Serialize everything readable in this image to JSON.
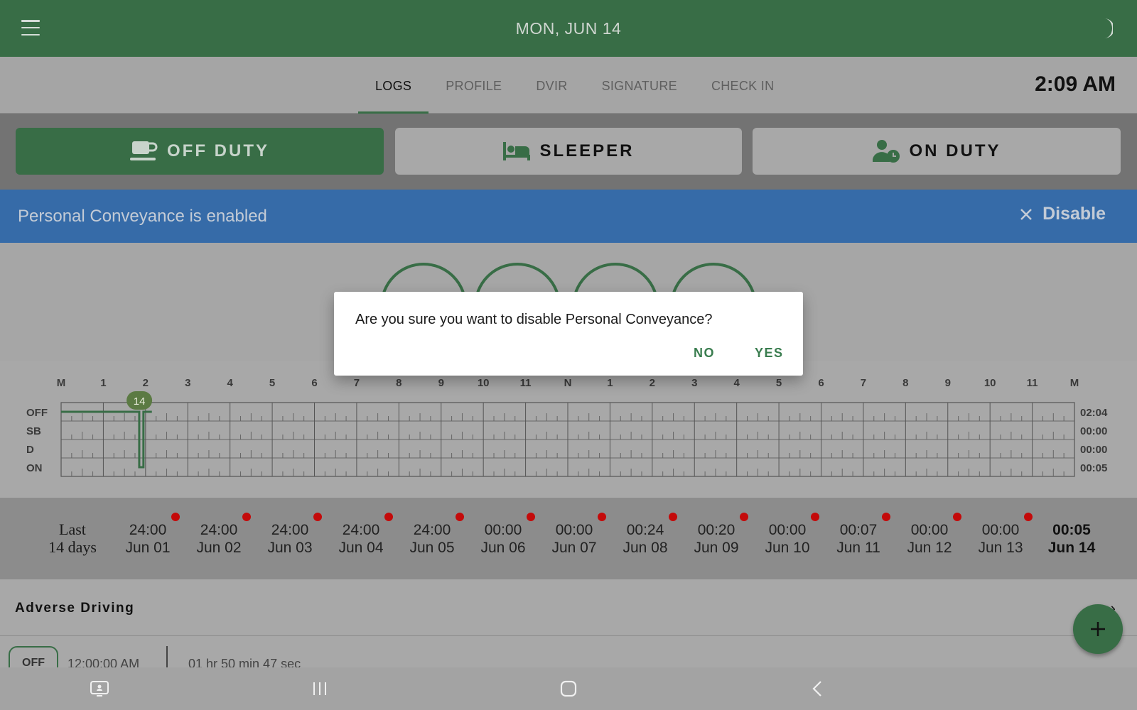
{
  "header": {
    "date": "MON, JUN 14"
  },
  "tabs": [
    {
      "label": "LOGS",
      "active": true
    },
    {
      "label": "PROFILE",
      "active": false
    },
    {
      "label": "DVIR",
      "active": false
    },
    {
      "label": "SIGNATURE",
      "active": false
    },
    {
      "label": "CHECK IN",
      "active": false
    }
  ],
  "clock": "2:09 AM",
  "status_buttons": {
    "off_duty": "OFF DUTY",
    "sleeper": "SLEEPER",
    "on_duty": "ON DUTY",
    "selected": "off_duty"
  },
  "banner": {
    "message": "Personal Conveyance is enabled",
    "action": "Disable"
  },
  "log_chart": {
    "hour_labels": [
      "M",
      "1",
      "2",
      "3",
      "4",
      "5",
      "6",
      "7",
      "8",
      "9",
      "10",
      "11",
      "N",
      "1",
      "2",
      "3",
      "4",
      "5",
      "6",
      "7",
      "8",
      "9",
      "10",
      "11",
      "M"
    ],
    "rows": [
      "OFF",
      "SB",
      "D",
      "ON"
    ],
    "totals": [
      "02:04",
      "00:00",
      "00:00",
      "00:05"
    ],
    "current_day_marker": "14"
  },
  "history": {
    "label_line1": "Last",
    "label_line2": "14 days",
    "days": [
      {
        "hours": "24:00",
        "date": "Jun 01",
        "violation": true
      },
      {
        "hours": "24:00",
        "date": "Jun 02",
        "violation": true
      },
      {
        "hours": "24:00",
        "date": "Jun 03",
        "violation": true
      },
      {
        "hours": "24:00",
        "date": "Jun 04",
        "violation": true
      },
      {
        "hours": "24:00",
        "date": "Jun 05",
        "violation": true
      },
      {
        "hours": "00:00",
        "date": "Jun 06",
        "violation": true
      },
      {
        "hours": "00:00",
        "date": "Jun 07",
        "violation": true
      },
      {
        "hours": "00:24",
        "date": "Jun 08",
        "violation": true
      },
      {
        "hours": "00:20",
        "date": "Jun 09",
        "violation": true
      },
      {
        "hours": "00:00",
        "date": "Jun 10",
        "violation": true
      },
      {
        "hours": "00:07",
        "date": "Jun 11",
        "violation": true
      },
      {
        "hours": "00:00",
        "date": "Jun 12",
        "violation": true
      },
      {
        "hours": "00:00",
        "date": "Jun 13",
        "violation": true
      },
      {
        "hours": "00:05",
        "date": "Jun 14",
        "violation": false,
        "current": true
      }
    ]
  },
  "adverse": {
    "title": "Adverse Driving"
  },
  "log_entry": {
    "status": "OFF",
    "time": "12:00:00 AM",
    "duration": "01 hr 50 min 47 sec"
  },
  "dialog": {
    "message": "Are you sure you want to disable Personal Conveyance?",
    "no": "NO",
    "yes": "YES"
  },
  "colors": {
    "brand_green": "#386d46",
    "banner_blue": "#366ba8",
    "violation_red": "#c40a0a"
  },
  "icons": [
    "menu-icon",
    "moon-icon",
    "coffee-icon",
    "bed-icon",
    "user-clock-icon",
    "close-icon",
    "chevron-right-icon",
    "plus-icon",
    "recent-apps-icon",
    "home-icon",
    "back-icon",
    "screen-icon"
  ]
}
